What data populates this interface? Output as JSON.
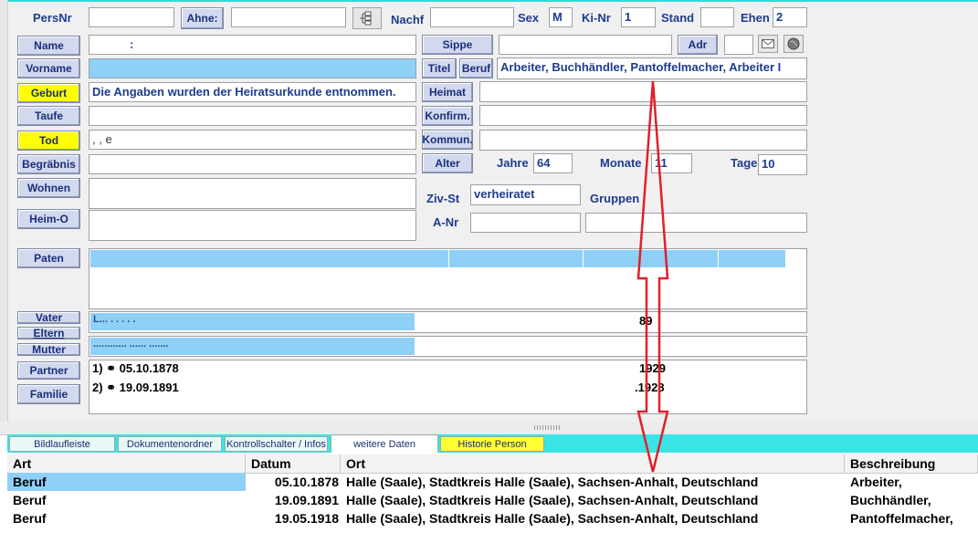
{
  "header": {
    "persnr_label": "PersNr",
    "ahne_button": "Ahne:",
    "nachf_label": "Nachf",
    "sex_label": "Sex",
    "sex_value": "M",
    "kinr_label": "Ki-Nr",
    "kinr_value": "1",
    "stand_label": "Stand",
    "ehen_label": "Ehen",
    "ehen_value": "2"
  },
  "left_buttons": {
    "name": "Name",
    "vorname": "Vorname",
    "geburt": "Geburt",
    "taufe": "Taufe",
    "tod": "Tod",
    "begraebnis": "Begräbnis",
    "wohnen": "Wohnen",
    "heimo": "Heim-O",
    "paten": "Paten",
    "vater": "Vater",
    "eltern": "Eltern",
    "mutter": "Mutter",
    "partner": "Partner",
    "familie": "Familie"
  },
  "fields": {
    "name_value": ":",
    "geburt_value": "Die Angaben wurden der Heiratsurkunde entnommen.",
    "tod_value": ", ,                                                      e"
  },
  "right_buttons": {
    "sippe": "Sippe",
    "adr": "Adr",
    "titel": "Titel",
    "beruf": "Beruf",
    "heimat": "Heimat",
    "konfirm": "Konfirm.",
    "kommun": "Kommun.",
    "alter": "Alter"
  },
  "right_fields": {
    "beruf_value": "Arbeiter, Buchhändler, Pantoffelmacher, Arbeiter I",
    "jahre_label": "Jahre",
    "jahre_value": "64",
    "monate_label": "Monate",
    "monate_value": "11",
    "tage_label": "Tage",
    "tage_value": "10",
    "zivst_label": "Ziv-St",
    "zivst_value": "verheiratet",
    "gruppen_label": "Gruppen",
    "anr_label": "A-Nr"
  },
  "parents": {
    "vater_year": "89",
    "vater_text": "L... . . . . .",
    "mutter_text": "............ ...... ......."
  },
  "partners": [
    {
      "label": "1) ⚭ 05.10.1878",
      "year": "1929"
    },
    {
      "label": "2) ⚭ 19.09.1891",
      "year": ".1928"
    }
  ],
  "tabs": {
    "t1": "Bildlaufleiste",
    "t2": "Dokumentenordner",
    "t3": "Kontrollschalter / Infos",
    "t4": "weitere Daten",
    "t5": "Historie Person"
  },
  "grid": {
    "headers": [
      "Art",
      "Datum",
      "Ort",
      "Beschreibung"
    ],
    "rows": [
      {
        "art": "Beruf",
        "datum": "05.10.1878",
        "ort": "Halle (Saale), Stadtkreis Halle (Saale), Sachsen-Anhalt, Deutschland",
        "beschreibung": "Arbeiter,"
      },
      {
        "art": "Beruf",
        "datum": "19.09.1891",
        "ort": "Halle (Saale), Stadtkreis Halle (Saale), Sachsen-Anhalt, Deutschland",
        "beschreibung": "Buchhändler,"
      },
      {
        "art": "Beruf",
        "datum": "19.05.1918",
        "ort": "Halle (Saale), Stadtkreis Halle (Saale), Sachsen-Anhalt, Deutschland",
        "beschreibung": "Pantoffelmacher,"
      }
    ]
  },
  "colors": {
    "accent_cyan": "#39e4e4",
    "button_blue": "#d2d8ee",
    "highlight_yellow": "#ffff00",
    "selection_blue": "#8fd0f7",
    "annotation_red": "#e0202a"
  },
  "icons": [
    "tree-icon",
    "mail-icon",
    "globe-icon",
    "marriage-icon",
    "red-double-arrow-annotation"
  ]
}
